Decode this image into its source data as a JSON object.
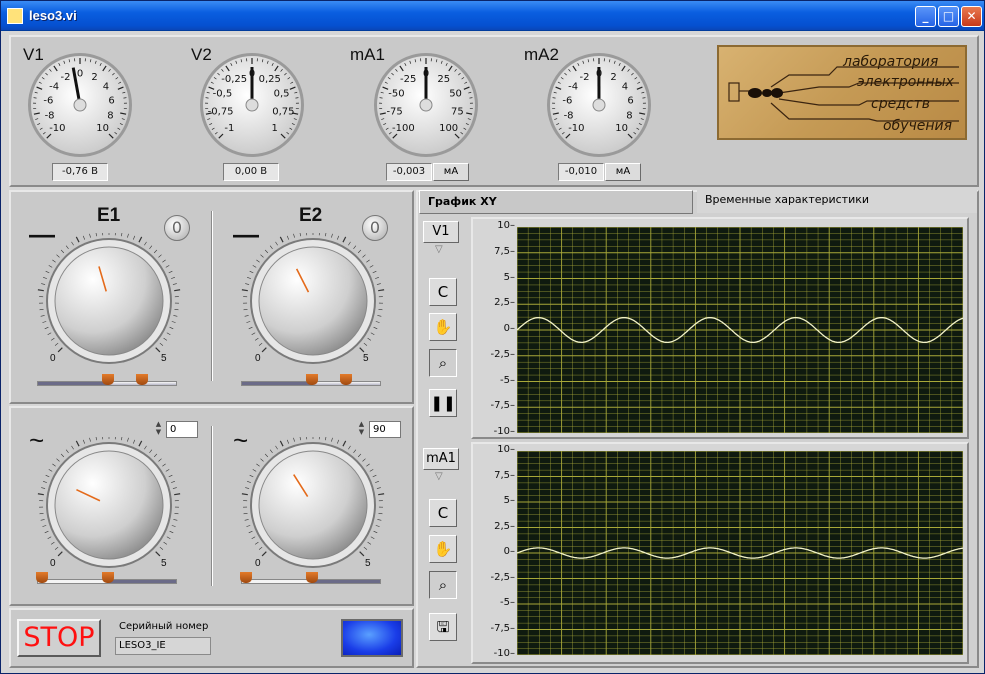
{
  "window": {
    "title": "leso3.vi",
    "minimize": "_",
    "maximize": "□",
    "close": "✕"
  },
  "meters": [
    {
      "label": "V1",
      "ticks": [
        "-2",
        "0",
        "2",
        "-4",
        "4",
        "-6",
        "6",
        "-8",
        "8",
        "-10",
        "10"
      ],
      "min": -10,
      "max": 10,
      "value": -0.76,
      "readout": "-0,76 В"
    },
    {
      "label": "V2",
      "ticks": [
        "-0,25",
        "0",
        "0,25",
        "-0,5",
        "0,5",
        "-0,75",
        "0,75",
        "-1",
        "1"
      ],
      "min": -1,
      "max": 1,
      "value": 0.0,
      "readout": "0,00 В"
    },
    {
      "label": "mA1",
      "ticks": [
        "-25",
        "0",
        "25",
        "-50",
        "50",
        "-75",
        "75",
        "-100",
        "100"
      ],
      "min": -100,
      "max": 100,
      "value": -0.003,
      "readout": "-0,003",
      "unit": "мА"
    },
    {
      "label": "mA2",
      "ticks": [
        "-2",
        "0",
        "2",
        "-4",
        "4",
        "-6",
        "6",
        "-8",
        "8",
        "-10",
        "10"
      ],
      "min": -10,
      "max": 10,
      "value": -0.01,
      "readout": "-0,010",
      "unit": "мА"
    }
  ],
  "logo": {
    "lines": [
      "лаборатория",
      "электронных",
      "средств",
      "обучения"
    ]
  },
  "dc_knobs": [
    {
      "label": "E1",
      "symbol": "—",
      "zero": "0",
      "scale_min": "0",
      "scale_max": "5",
      "value": 2.2
    },
    {
      "label": "E2",
      "symbol": "—",
      "zero": "0",
      "scale_min": "0",
      "scale_max": "5",
      "value": 2.0
    }
  ],
  "ac_knobs": [
    {
      "symbol": "~",
      "phase": "0",
      "scale_min": "0",
      "scale_max": "5",
      "value": 1.3
    },
    {
      "symbol": "~",
      "phase": "90",
      "scale_min": "0",
      "scale_max": "5",
      "value": 1.9
    }
  ],
  "bottom": {
    "stop": "STOP",
    "serial_label": "Серийный номер",
    "serial_value": "LESO3_IE"
  },
  "tabs": {
    "xy": "График XY",
    "time": "Временные характеристики"
  },
  "channels": [
    {
      "label": "V1",
      "tool_clear": "C"
    },
    {
      "label": "mA1",
      "tool_clear": "C"
    }
  ],
  "y_ticks": [
    "10",
    "7,5",
    "5",
    "2,5",
    "0",
    "-2,5",
    "-5",
    "-7,5",
    "-10"
  ],
  "colors": {
    "plot_bg": "#0f1a0f",
    "grid": "#a8a838",
    "trace": "#f2f2c8"
  },
  "chart_data": [
    {
      "type": "line",
      "title": "V1",
      "ylim": [
        -10,
        10
      ],
      "xlim": [
        0,
        10
      ],
      "amplitude": 1.2,
      "cycles": 5.2,
      "offset": 0,
      "phase": 0
    },
    {
      "type": "line",
      "title": "mA1",
      "ylim": [
        -10,
        10
      ],
      "xlim": [
        0,
        10
      ],
      "amplitude": 0.5,
      "cycles": 5.2,
      "offset": 0,
      "phase": 0
    }
  ]
}
